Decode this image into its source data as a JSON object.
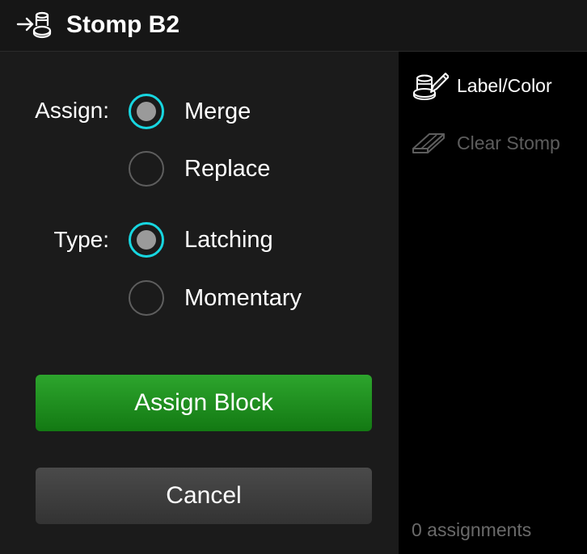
{
  "header": {
    "icon": "footswitch-assign-icon",
    "title": "Stomp B2"
  },
  "assign": {
    "label": "Assign:",
    "options": [
      {
        "label": "Merge",
        "checked": true
      },
      {
        "label": "Replace",
        "checked": false
      }
    ]
  },
  "type": {
    "label": "Type:",
    "options": [
      {
        "label": "Latching",
        "checked": true
      },
      {
        "label": "Momentary",
        "checked": false
      }
    ]
  },
  "buttons": {
    "assign_label": "Assign Block",
    "cancel_label": "Cancel"
  },
  "side": {
    "label_color": {
      "label": "Label/Color",
      "icon": "stack-pencil-icon",
      "enabled": true
    },
    "clear_stomp": {
      "label": "Clear Stomp",
      "icon": "eraser-icon",
      "enabled": false
    },
    "assignments_text": "0 assignments"
  },
  "colors": {
    "accent": "#17d6e0",
    "assign_button": "#1f8f1f",
    "cancel_button": "#3f3f3f",
    "background": "#1b1b1b",
    "sidebar": "#000000"
  }
}
